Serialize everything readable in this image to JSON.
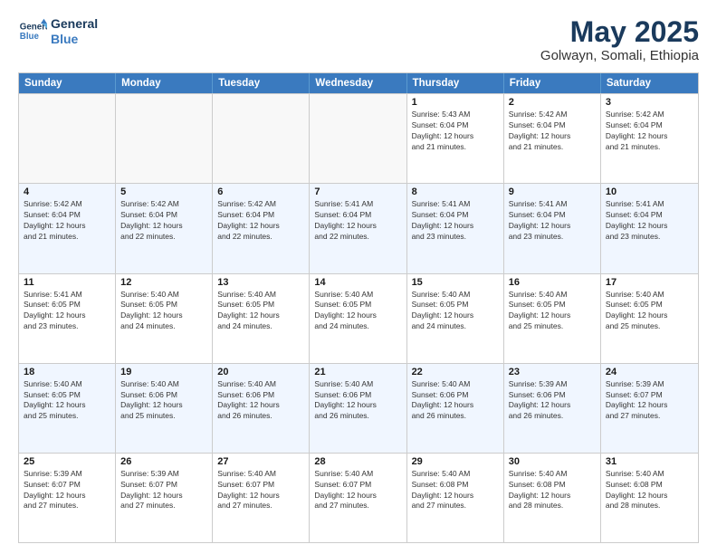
{
  "logo": {
    "line1": "General",
    "line2": "Blue"
  },
  "title": {
    "month_year": "May 2025",
    "location": "Golwayn, Somali, Ethiopia"
  },
  "days_of_week": [
    "Sunday",
    "Monday",
    "Tuesday",
    "Wednesday",
    "Thursday",
    "Friday",
    "Saturday"
  ],
  "weeks": [
    [
      {
        "day": "",
        "info": ""
      },
      {
        "day": "",
        "info": ""
      },
      {
        "day": "",
        "info": ""
      },
      {
        "day": "",
        "info": ""
      },
      {
        "day": "1",
        "info": "Sunrise: 5:43 AM\nSunset: 6:04 PM\nDaylight: 12 hours\nand 21 minutes."
      },
      {
        "day": "2",
        "info": "Sunrise: 5:42 AM\nSunset: 6:04 PM\nDaylight: 12 hours\nand 21 minutes."
      },
      {
        "day": "3",
        "info": "Sunrise: 5:42 AM\nSunset: 6:04 PM\nDaylight: 12 hours\nand 21 minutes."
      }
    ],
    [
      {
        "day": "4",
        "info": "Sunrise: 5:42 AM\nSunset: 6:04 PM\nDaylight: 12 hours\nand 21 minutes."
      },
      {
        "day": "5",
        "info": "Sunrise: 5:42 AM\nSunset: 6:04 PM\nDaylight: 12 hours\nand 22 minutes."
      },
      {
        "day": "6",
        "info": "Sunrise: 5:42 AM\nSunset: 6:04 PM\nDaylight: 12 hours\nand 22 minutes."
      },
      {
        "day": "7",
        "info": "Sunrise: 5:41 AM\nSunset: 6:04 PM\nDaylight: 12 hours\nand 22 minutes."
      },
      {
        "day": "8",
        "info": "Sunrise: 5:41 AM\nSunset: 6:04 PM\nDaylight: 12 hours\nand 23 minutes."
      },
      {
        "day": "9",
        "info": "Sunrise: 5:41 AM\nSunset: 6:04 PM\nDaylight: 12 hours\nand 23 minutes."
      },
      {
        "day": "10",
        "info": "Sunrise: 5:41 AM\nSunset: 6:04 PM\nDaylight: 12 hours\nand 23 minutes."
      }
    ],
    [
      {
        "day": "11",
        "info": "Sunrise: 5:41 AM\nSunset: 6:05 PM\nDaylight: 12 hours\nand 23 minutes."
      },
      {
        "day": "12",
        "info": "Sunrise: 5:40 AM\nSunset: 6:05 PM\nDaylight: 12 hours\nand 24 minutes."
      },
      {
        "day": "13",
        "info": "Sunrise: 5:40 AM\nSunset: 6:05 PM\nDaylight: 12 hours\nand 24 minutes."
      },
      {
        "day": "14",
        "info": "Sunrise: 5:40 AM\nSunset: 6:05 PM\nDaylight: 12 hours\nand 24 minutes."
      },
      {
        "day": "15",
        "info": "Sunrise: 5:40 AM\nSunset: 6:05 PM\nDaylight: 12 hours\nand 24 minutes."
      },
      {
        "day": "16",
        "info": "Sunrise: 5:40 AM\nSunset: 6:05 PM\nDaylight: 12 hours\nand 25 minutes."
      },
      {
        "day": "17",
        "info": "Sunrise: 5:40 AM\nSunset: 6:05 PM\nDaylight: 12 hours\nand 25 minutes."
      }
    ],
    [
      {
        "day": "18",
        "info": "Sunrise: 5:40 AM\nSunset: 6:05 PM\nDaylight: 12 hours\nand 25 minutes."
      },
      {
        "day": "19",
        "info": "Sunrise: 5:40 AM\nSunset: 6:06 PM\nDaylight: 12 hours\nand 25 minutes."
      },
      {
        "day": "20",
        "info": "Sunrise: 5:40 AM\nSunset: 6:06 PM\nDaylight: 12 hours\nand 26 minutes."
      },
      {
        "day": "21",
        "info": "Sunrise: 5:40 AM\nSunset: 6:06 PM\nDaylight: 12 hours\nand 26 minutes."
      },
      {
        "day": "22",
        "info": "Sunrise: 5:40 AM\nSunset: 6:06 PM\nDaylight: 12 hours\nand 26 minutes."
      },
      {
        "day": "23",
        "info": "Sunrise: 5:39 AM\nSunset: 6:06 PM\nDaylight: 12 hours\nand 26 minutes."
      },
      {
        "day": "24",
        "info": "Sunrise: 5:39 AM\nSunset: 6:07 PM\nDaylight: 12 hours\nand 27 minutes."
      }
    ],
    [
      {
        "day": "25",
        "info": "Sunrise: 5:39 AM\nSunset: 6:07 PM\nDaylight: 12 hours\nand 27 minutes."
      },
      {
        "day": "26",
        "info": "Sunrise: 5:39 AM\nSunset: 6:07 PM\nDaylight: 12 hours\nand 27 minutes."
      },
      {
        "day": "27",
        "info": "Sunrise: 5:40 AM\nSunset: 6:07 PM\nDaylight: 12 hours\nand 27 minutes."
      },
      {
        "day": "28",
        "info": "Sunrise: 5:40 AM\nSunset: 6:07 PM\nDaylight: 12 hours\nand 27 minutes."
      },
      {
        "day": "29",
        "info": "Sunrise: 5:40 AM\nSunset: 6:08 PM\nDaylight: 12 hours\nand 27 minutes."
      },
      {
        "day": "30",
        "info": "Sunrise: 5:40 AM\nSunset: 6:08 PM\nDaylight: 12 hours\nand 28 minutes."
      },
      {
        "day": "31",
        "info": "Sunrise: 5:40 AM\nSunset: 6:08 PM\nDaylight: 12 hours\nand 28 minutes."
      }
    ]
  ]
}
